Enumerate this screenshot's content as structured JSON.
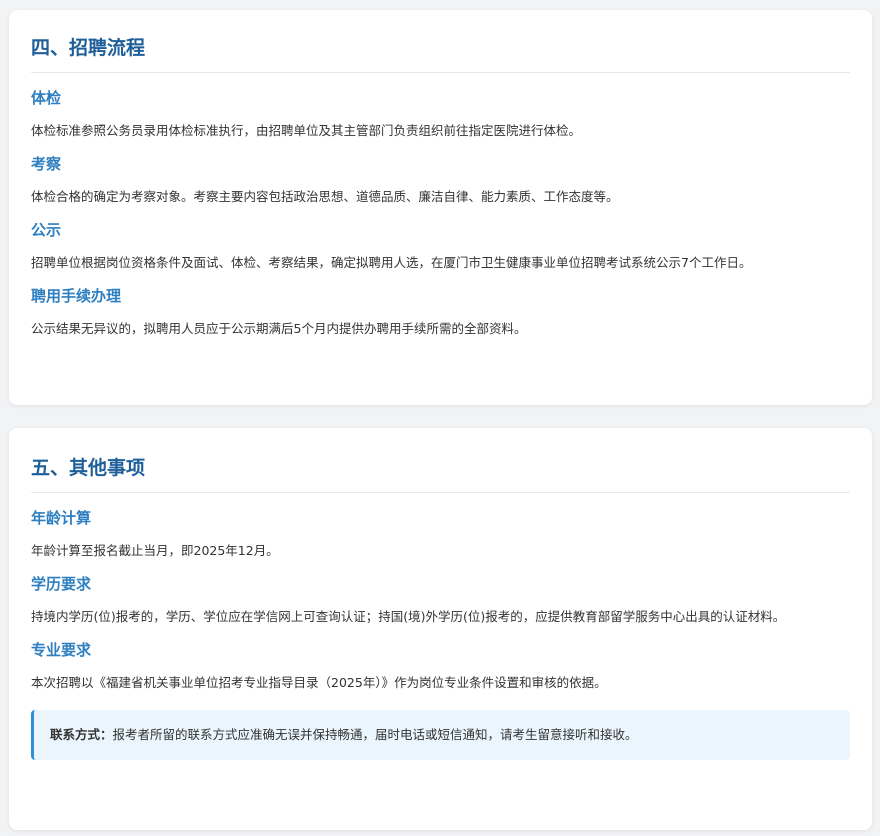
{
  "sections": [
    {
      "title": "四、招聘流程",
      "items": [
        {
          "heading": "体检",
          "text": "体检标准参照公务员录用体检标准执行，由招聘单位及其主管部门负责组织前往指定医院进行体检。"
        },
        {
          "heading": "考察",
          "text": "体检合格的确定为考察对象。考察主要内容包括政治思想、道德品质、廉洁自律、能力素质、工作态度等。"
        },
        {
          "heading": "公示",
          "text": "招聘单位根据岗位资格条件及面试、体检、考察结果，确定拟聘用人选，在厦门市卫生健康事业单位招聘考试系统公示7个工作日。"
        },
        {
          "heading": "聘用手续办理",
          "text": "公示结果无异议的，拟聘用人员应于公示期满后5个月内提供办聘用手续所需的全部资料。"
        }
      ]
    },
    {
      "title": "五、其他事项",
      "items": [
        {
          "heading": "年龄计算",
          "text": "年龄计算至报名截止当月，即2025年12月。"
        },
        {
          "heading": "学历要求",
          "text": "持境内学历(位)报考的，学历、学位应在学信网上可查询认证；持国(境)外学历(位)报考的，应提供教育部留学服务中心出具的认证材料。"
        },
        {
          "heading": "专业要求",
          "text": "本次招聘以《福建省机关事业单位招考专业指导目录（2025年）》作为岗位专业条件设置和审核的依据。"
        }
      ],
      "notice": {
        "label": "联系方式：",
        "text": "报考者所留的联系方式应准确无误并保持畅通，届时电话或短信通知，请考生留意接听和接收。"
      }
    }
  ]
}
